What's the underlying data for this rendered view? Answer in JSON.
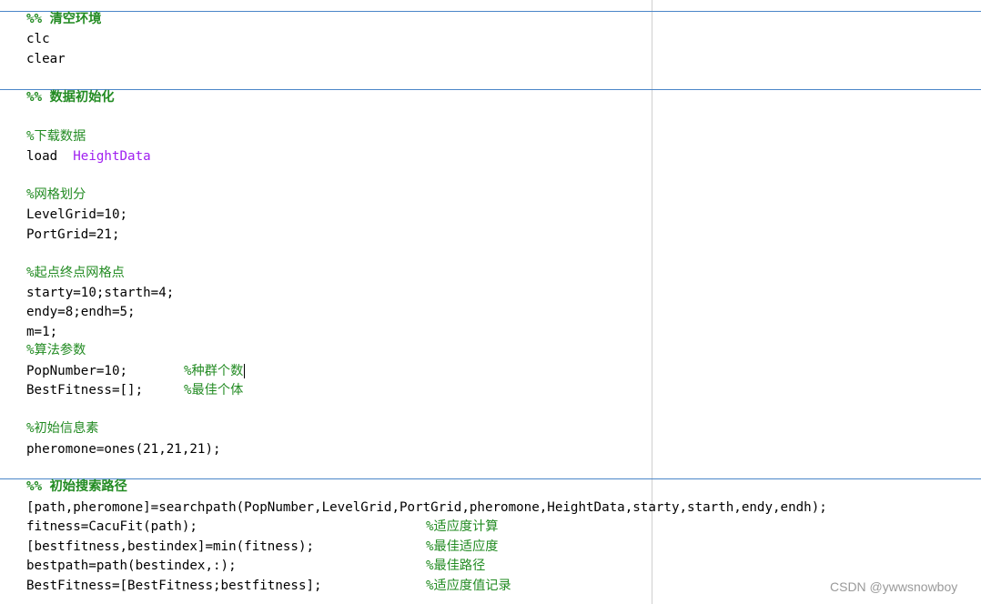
{
  "cells": [
    {
      "header": "%% 清空环境",
      "lines": [
        "clc",
        "clear"
      ]
    },
    {
      "header": "%% 数据初始化"
    },
    {
      "header": "%% 初始搜索路径"
    }
  ],
  "code": {
    "load_kw": "load",
    "load_arg": "HeightData",
    "c_grid": "%网格划分",
    "c_download": "%下载数据",
    "level": "LevelGrid=10;",
    "port": "PortGrid=21;",
    "c_start_end": "%起点终点网格点",
    "start": "starty=10;starth=4;",
    "end": "endy=8;endh=5;",
    "m": "m=1;",
    "c_algo": "%算法参数",
    "pop": "PopNumber=10;",
    "c_pop": "%种群个数",
    "best": "BestFitness=[];",
    "c_best": "%最佳个体",
    "c_pher": "%初始信息素",
    "pher": "pheromone=ones(21,21,21);",
    "search": "[path,pheromone]=searchpath(PopNumber,LevelGrid,PortGrid,pheromone,HeightData,starty,starth,endy,endh);",
    "fit": "fitness=CacuFit(path);",
    "c_fit": "%适应度计算",
    "bestfit": "[bestfitness,bestindex]=min(fitness);",
    "c_bestfit": "%最佳适应度",
    "bestpath": "bestpath=path(bestindex,:);",
    "c_bestpath": "%最佳路径",
    "record": "BestFitness=[BestFitness;bestfitness];",
    "c_record": "%适应度值记录"
  },
  "watermark": "CSDN @ywwsnowboy",
  "colors": {
    "comment": "#228b22",
    "string": "#a020f0",
    "cell_divider": "#4a86c8",
    "right_margin": "#cfcfcf"
  }
}
